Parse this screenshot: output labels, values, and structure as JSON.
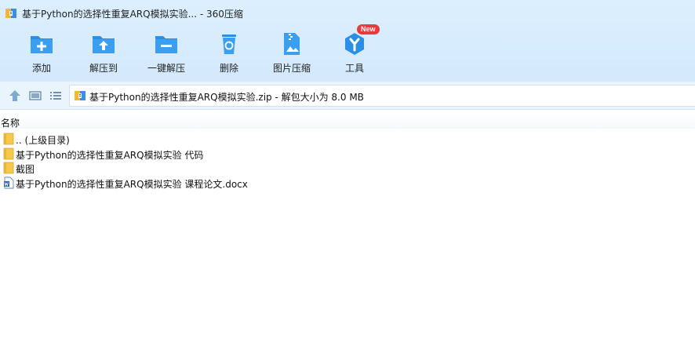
{
  "window": {
    "title": "基于Python的选择性重复ARQ模拟实验... - 360压缩"
  },
  "toolbar": {
    "buttons": [
      {
        "label": "添加",
        "icon": "add-icon"
      },
      {
        "label": "解压到",
        "icon": "extract-to-icon"
      },
      {
        "label": "一键解压",
        "icon": "one-click-extract-icon"
      },
      {
        "label": "删除",
        "icon": "delete-icon"
      },
      {
        "label": "图片压缩",
        "icon": "image-compress-icon"
      },
      {
        "label": "工具",
        "icon": "tools-icon",
        "badge": "New"
      }
    ]
  },
  "nav": {
    "address_text": "基于Python的选择性重复ARQ模拟实验.zip - 解包大小为 8.0 MB"
  },
  "list": {
    "column_name": "名称",
    "items": [
      {
        "name": ".. (上级目录)",
        "type": "parent-folder"
      },
      {
        "name": "基于Python的选择性重复ARQ模拟实验 代码",
        "type": "folder"
      },
      {
        "name": "截图",
        "type": "folder"
      },
      {
        "name": "基于Python的选择性重复ARQ模拟实验 课程论文.docx",
        "type": "word-document"
      }
    ]
  },
  "colors": {
    "accent": "#2b8fe6",
    "toolbar_bg": "#d8edff",
    "badge": "#e83b3b",
    "folder": "#f7c948"
  }
}
